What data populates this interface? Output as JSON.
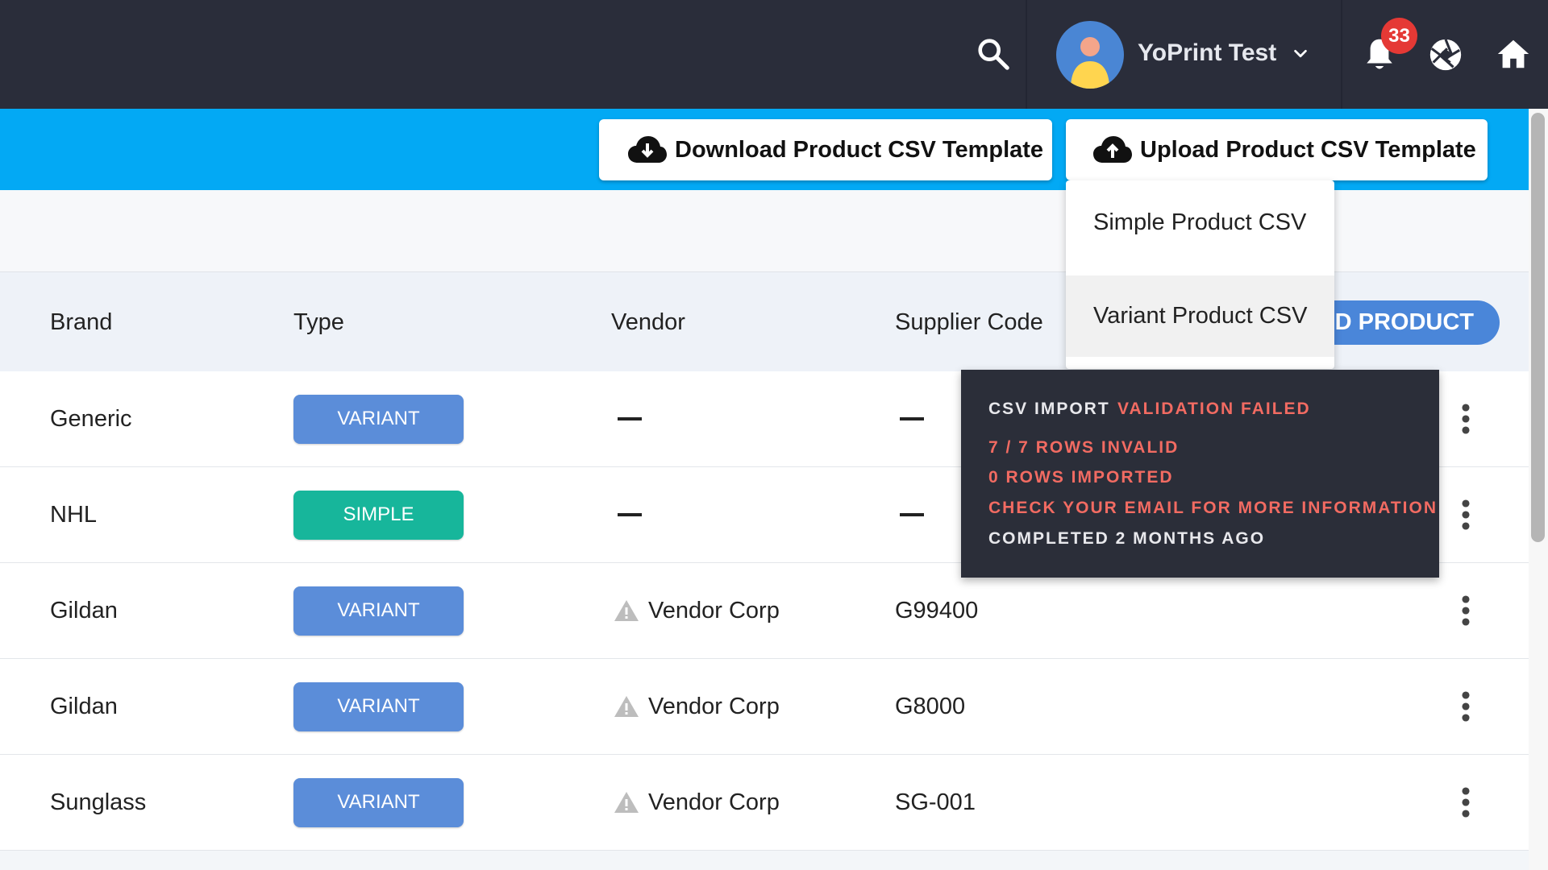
{
  "topbar": {
    "user_name": "YoPrint Test",
    "notification_count": "33"
  },
  "actions": {
    "download_label": "Download Product CSV Template",
    "upload_label": "Upload Product CSV Template"
  },
  "upload_menu": {
    "items": [
      "Simple Product CSV",
      "Variant Product CSV"
    ]
  },
  "table": {
    "headers": {
      "brand": "Brand",
      "type": "Type",
      "vendor": "Vendor",
      "supplier_code": "Supplier Code"
    },
    "add_button_visible": "DD PRODUCT",
    "rows": [
      {
        "brand": "Generic",
        "type": "VARIANT",
        "vendor": "",
        "supplier_code": ""
      },
      {
        "brand": "NHL",
        "type": "SIMPLE",
        "vendor": "",
        "supplier_code": ""
      },
      {
        "brand": "Gildan",
        "type": "VARIANT",
        "vendor": "Vendor Corp",
        "supplier_code": "G99400"
      },
      {
        "brand": "Gildan",
        "type": "VARIANT",
        "vendor": "Vendor Corp",
        "supplier_code": "G8000"
      },
      {
        "brand": "Sunglass",
        "type": "VARIANT",
        "vendor": "Vendor Corp",
        "supplier_code": "SG-001"
      }
    ]
  },
  "toast": {
    "title": "CSV IMPORT",
    "status": "VALIDATION FAILED",
    "rows_invalid": "7 / 7 ROWS INVALID",
    "rows_imported": "0 ROWS IMPORTED",
    "email_note": "CHECK YOUR EMAIL FOR MORE INFORMATION",
    "completed": "COMPLETED 2 MONTHS AGO"
  },
  "colors": {
    "topbar": "#2a2d3a",
    "action_bar": "#03a9f4",
    "variant_pill": "#5b8dd9",
    "simple_pill": "#17b69b",
    "error_text": "#f26b62",
    "badge": "#e53935"
  },
  "icons": {
    "search": "search-icon",
    "avatar": "user-avatar",
    "notifications": "bell-icon",
    "aperture": "aperture-icon",
    "home": "home-icon",
    "download": "cloud-download-icon",
    "upload": "cloud-upload-icon",
    "warning": "warning-icon",
    "row_menu": "more-vert-icon"
  }
}
